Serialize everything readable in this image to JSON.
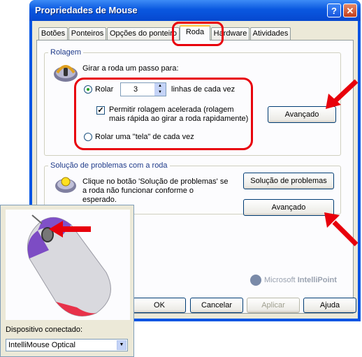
{
  "window": {
    "title": "Propriedades de Mouse",
    "help": "?",
    "close": "✕"
  },
  "tabs": [
    "Botões",
    "Ponteiros",
    "Opções do ponteiro",
    "Roda",
    "Hardware",
    "Atividades"
  ],
  "scroll_group": {
    "label": "Rolagem",
    "heading": "Girar a roda um passo para:",
    "rolar_label": "Rolar",
    "lines_value": "3",
    "lines_suffix": "linhas de cada vez",
    "accel_label": "Permitir rolagem acelerada (rolagem mais rápida ao girar a roda rapidamente)",
    "screen_label": "Rolar uma \"tela\" de cada vez",
    "advanced_button": "Avançado"
  },
  "troubleshoot_group": {
    "label": "Solução de problemas com a roda",
    "text": "Clique no botão 'Solução de problemas' se a roda não funcionar conforme o esperado.",
    "troubleshoot_button": "Solução de problemas",
    "advanced_button": "Avançado"
  },
  "branding": {
    "brand_light": "Microsoft",
    "brand_bold": "IntelliPoint"
  },
  "dialog_buttons": {
    "ok": "OK",
    "cancel": "Cancelar",
    "apply": "Aplicar",
    "help": "Ajuda"
  },
  "device": {
    "label": "Dispositivo conectado:",
    "selected": "IntelliMouse Optical"
  },
  "colors": {
    "annotation": "#e8000c",
    "titlebar": "#0a58e0"
  }
}
